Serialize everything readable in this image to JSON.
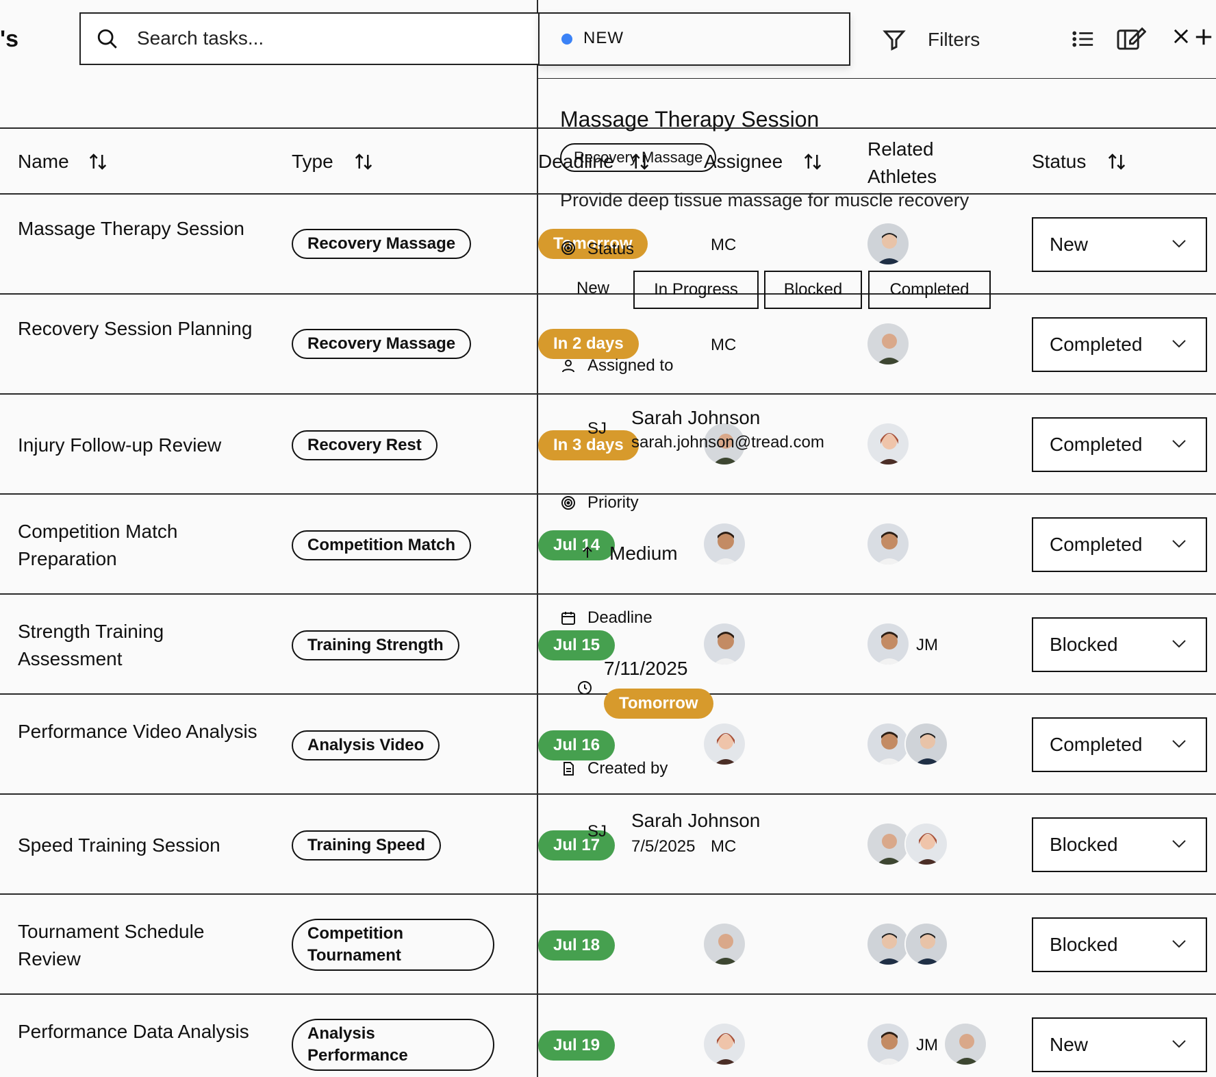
{
  "header": {
    "title_fragment": "'s",
    "search_placeholder": "Search tasks...",
    "status_chip": "NEW",
    "filters_label": "Filters"
  },
  "columns": {
    "name": "Name",
    "type": "Type",
    "deadline": "Deadline",
    "assignee": "Assignee",
    "related": "Related Athletes",
    "status": "Status"
  },
  "rows": [
    {
      "name": "Massage Therapy Session",
      "type": "Recovery Massage",
      "deadline": "Tomorrow",
      "assignee": "MC",
      "status": "New"
    },
    {
      "name": "Recovery Session Planning",
      "type": "Recovery Massage",
      "deadline": "In 2 days",
      "assignee": "MC",
      "status": "Completed"
    },
    {
      "name": "Injury Follow-up Review",
      "type": "Recovery Rest",
      "deadline": "In 3 days",
      "assignee": "SJ",
      "status": "Completed"
    },
    {
      "name": "Competition Match Preparation",
      "type": "Competition Match",
      "deadline": "Jul 14",
      "assignee": "",
      "status": "Completed"
    },
    {
      "name": "Strength Training Assessment",
      "type": "Training Strength",
      "deadline": "Jul 15",
      "assignee": "",
      "related_initials": "JM",
      "status": "Blocked"
    },
    {
      "name": "Performance Video Analysis",
      "type": "Analysis Video",
      "deadline": "Jul 16",
      "assignee": "",
      "status": "Completed"
    },
    {
      "name": "Speed Training Session",
      "type": "Training Speed",
      "deadline": "Jul 17",
      "assignee": "MC",
      "status": "Blocked"
    },
    {
      "name": "Tournament Schedule Review",
      "type": "Competition Tournament",
      "deadline": "Jul 18",
      "assignee": "",
      "status": "Blocked"
    },
    {
      "name": "Performance Data Analysis",
      "type": "Analysis Performance",
      "deadline": "Jul 19",
      "assignee": "",
      "related_initials": "JM",
      "status": "New"
    }
  ],
  "detail": {
    "title": "Massage Therapy Session",
    "type": "Recovery Massage",
    "description": "Provide deep tissue massage for muscle recovery",
    "status_label": "Status",
    "status_options": [
      "New",
      "In Progress",
      "Blocked",
      "Completed"
    ],
    "assigned_label": "Assigned to",
    "assigned_initials": "SJ",
    "assigned_name": "Sarah Johnson",
    "assigned_email": "sarah.johnson@tread.com",
    "priority_label": "Priority",
    "priority_value": "Medium",
    "deadline_label": "Deadline",
    "deadline_value": "7/11/2025",
    "deadline_relative": "Tomorrow",
    "created_label": "Created by",
    "created_initials": "SJ",
    "created_name": "Sarah Johnson",
    "created_date": "7/5/2025"
  },
  "colors": {
    "deadline_green": "#46a04f",
    "deadline_amber": "#d79a2c",
    "status_dot": "#3b82f6"
  }
}
